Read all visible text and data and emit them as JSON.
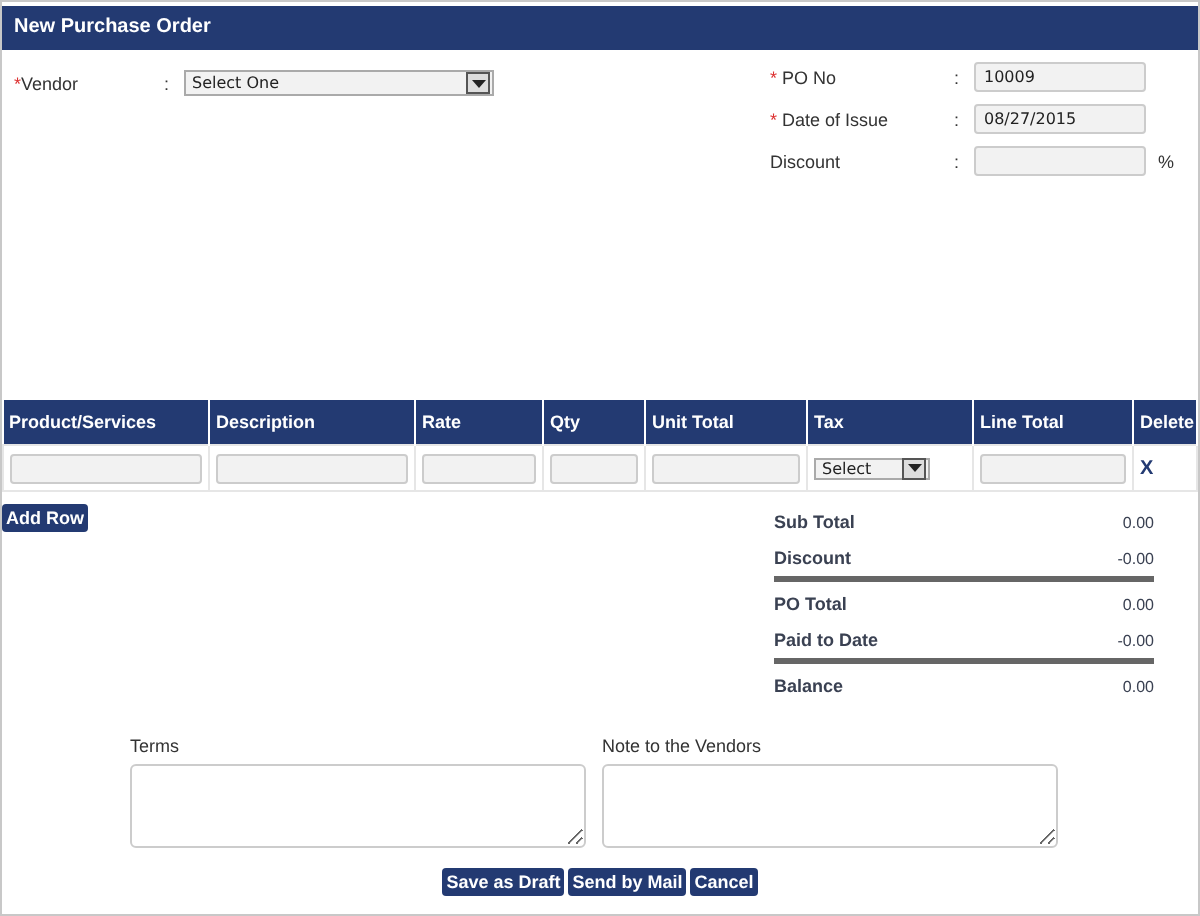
{
  "header": {
    "title": "New Purchase Order"
  },
  "vendor": {
    "label": "Vendor",
    "required_mark": "*",
    "separator": ":",
    "value": "Select One"
  },
  "fields": [
    {
      "label": "PO No",
      "required_mark": "*",
      "separator": ":",
      "value": "10009"
    },
    {
      "label": "Date of Issue",
      "required_mark": "*",
      "separator": ":",
      "value": "08/27/2015"
    },
    {
      "label": "Discount",
      "separator": ":",
      "suffix": "%"
    }
  ],
  "table": {
    "columns": [
      "Product/Services",
      "Description",
      "Rate",
      "Qty",
      "Unit Total",
      "Tax",
      "Line Total",
      "Delete"
    ],
    "rows": [
      {
        "tax": "Select",
        "delete": "X"
      }
    ]
  },
  "add_row": "Add Row",
  "totals": [
    {
      "label": "Sub Total",
      "value": "0.00",
      "rule_after": false
    },
    {
      "label": "Discount",
      "value": "-0.00",
      "rule_after": true
    },
    {
      "label": "PO Total",
      "value": "0.00",
      "rule_after": false
    },
    {
      "label": "Paid to Date",
      "value": "-0.00",
      "rule_after": true
    },
    {
      "label": "Balance",
      "value": "0.00",
      "rule_after": false
    }
  ],
  "notes": [
    {
      "label": "Terms"
    },
    {
      "label": "Note to the Vendors"
    }
  ],
  "buttons": [
    "Save as Draft",
    "Send by Mail",
    "Cancel"
  ]
}
